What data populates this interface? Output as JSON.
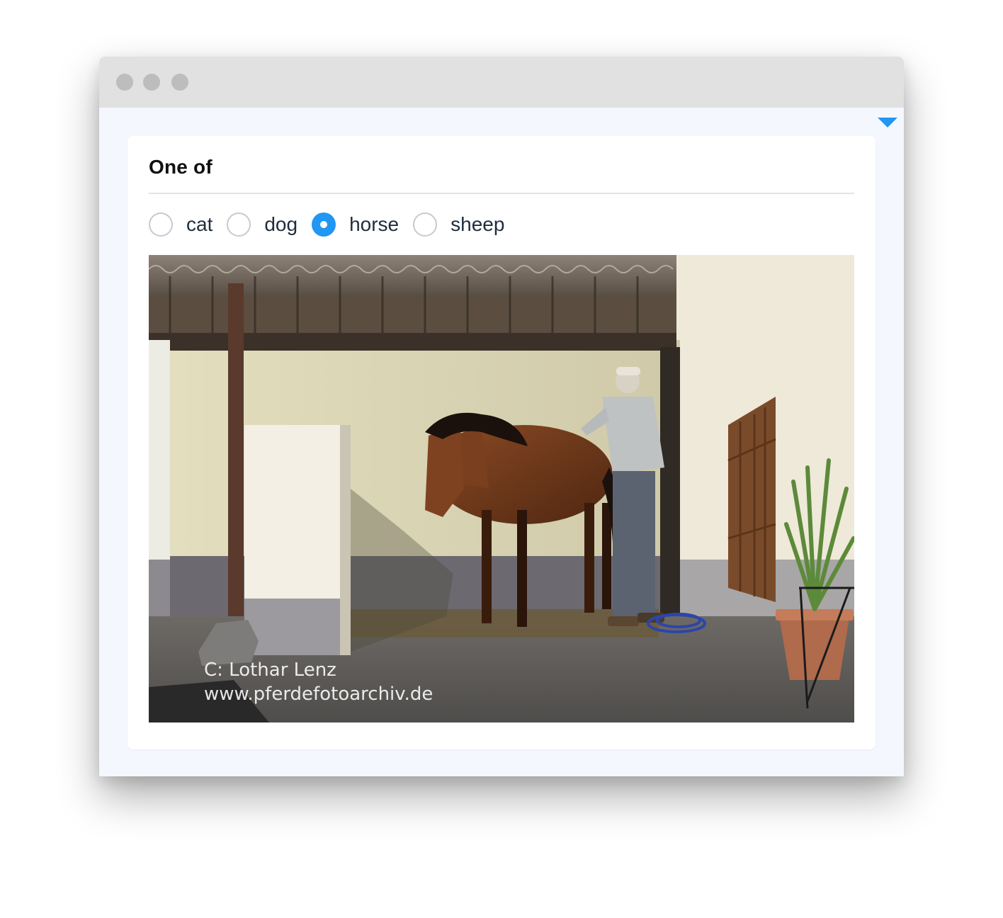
{
  "window": {
    "controls": [
      "close",
      "minimize",
      "maximize"
    ]
  },
  "toolbar": {
    "collapse_icon": "triangle-down-icon",
    "accent_color": "#2196f3"
  },
  "question": {
    "title": "One of",
    "choices": [
      {
        "label": "cat",
        "checked": false
      },
      {
        "label": "dog",
        "checked": false
      },
      {
        "label": "horse",
        "checked": true
      },
      {
        "label": "sheep",
        "checked": false
      }
    ],
    "selected": "horse"
  },
  "photo": {
    "watermark_line1": "C:   Lothar Lenz",
    "watermark_line2": "www.pferdefotoarchiv.de"
  }
}
